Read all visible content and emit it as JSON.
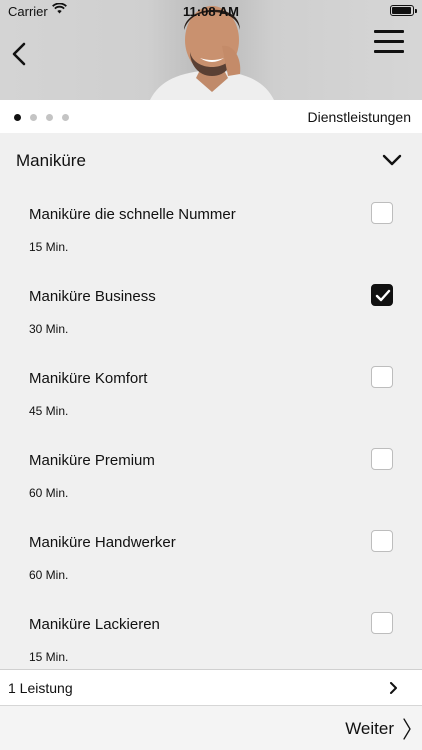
{
  "status_bar": {
    "carrier": "Carrier",
    "time": "11:08 AM",
    "wifi_icon": "wifi-icon",
    "battery_icon": "battery-icon"
  },
  "header": {
    "back_icon": "chevron-left-icon",
    "menu_icon": "hamburger-menu-icon",
    "hero_image": "smiling man portrait"
  },
  "pager": {
    "total_steps": 4,
    "current_step": 1,
    "title": "Dienstleistungen"
  },
  "section": {
    "title": "Maniküre",
    "expanded_icon": "chevron-down-icon"
  },
  "services": [
    {
      "name": "Maniküre die schnelle Nummer",
      "duration": "15 Min.",
      "selected": false
    },
    {
      "name": "Maniküre Business",
      "duration": "30 Min.",
      "selected": true
    },
    {
      "name": "Maniküre Komfort",
      "duration": "45 Min.",
      "selected": false
    },
    {
      "name": "Maniküre Premium",
      "duration": "60 Min.",
      "selected": false
    },
    {
      "name": "Maniküre Handwerker",
      "duration": "60 Min.",
      "selected": false
    },
    {
      "name": "Maniküre Lackieren",
      "duration": "15 Min.",
      "selected": false
    }
  ],
  "summary": {
    "text": "1 Leistung",
    "icon": "chevron-right-icon"
  },
  "footer": {
    "next_label": "Weiter",
    "next_icon": "chevron-right-thin-icon"
  },
  "colors": {
    "background": "#f0f0f0",
    "surface": "#ffffff",
    "text": "#111111",
    "checkbox_checked": "#111111",
    "dot_inactive": "#c4c4c4"
  }
}
